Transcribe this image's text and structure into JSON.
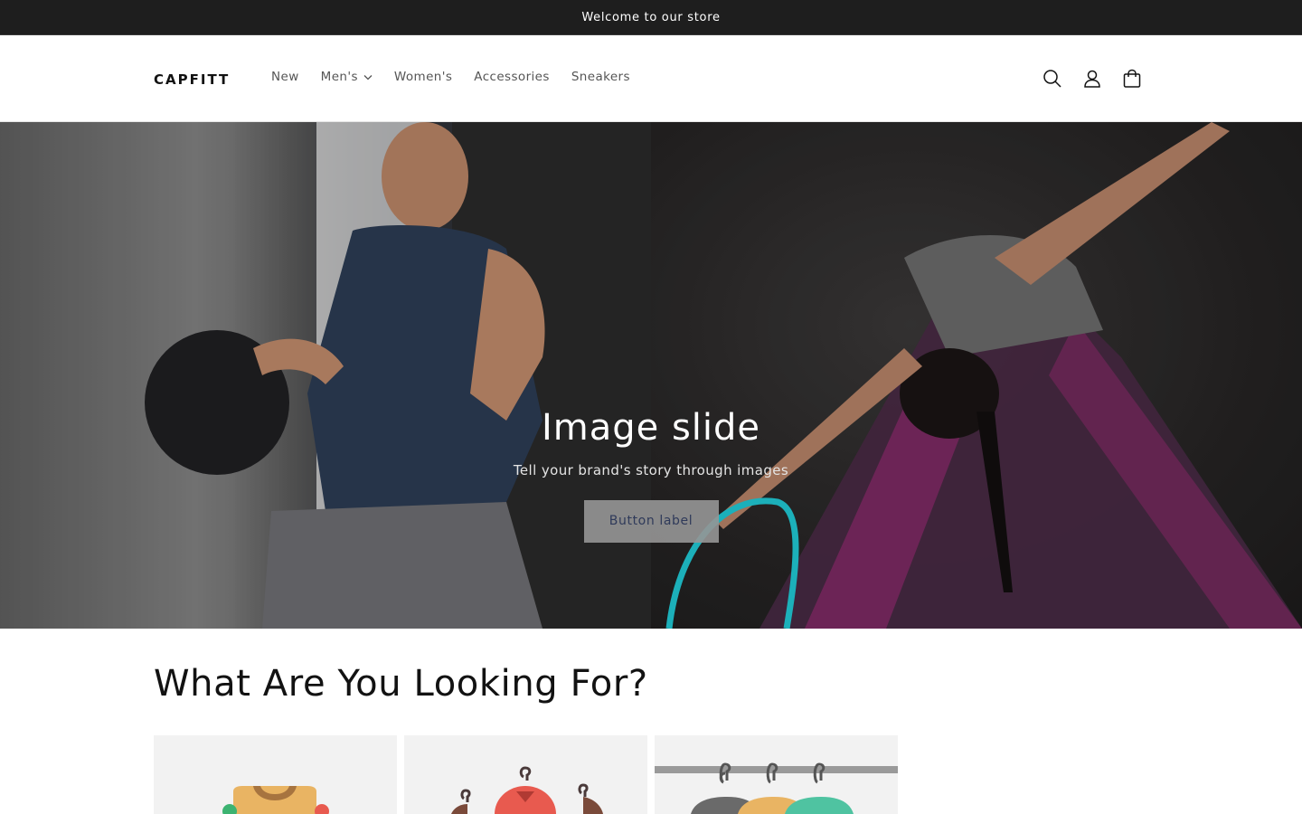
{
  "announcement": {
    "text": "Welcome to our store"
  },
  "header": {
    "logo_text": "CAPFITT",
    "nav": [
      {
        "label": "New",
        "has_dropdown": false
      },
      {
        "label": "Men's",
        "has_dropdown": true
      },
      {
        "label": "Women's",
        "has_dropdown": false
      },
      {
        "label": "Accessories",
        "has_dropdown": false
      },
      {
        "label": "Sneakers",
        "has_dropdown": false
      }
    ],
    "icons": [
      "search-icon",
      "account-icon",
      "cart-icon"
    ]
  },
  "hero": {
    "title": "Image slide",
    "subtitle": "Tell your brand's story through images",
    "button_label": "Button label"
  },
  "collections": {
    "title": "What Are You Looking For?",
    "card_icons": [
      "folded-shirts-icon",
      "hanging-shirts-icon",
      "clothes-rack-icon"
    ]
  },
  "colors": {
    "announcement_bg": "#1e1e1e",
    "text": "#121212",
    "nav_text": "#555555",
    "card_bg": "#f2f2f2"
  }
}
